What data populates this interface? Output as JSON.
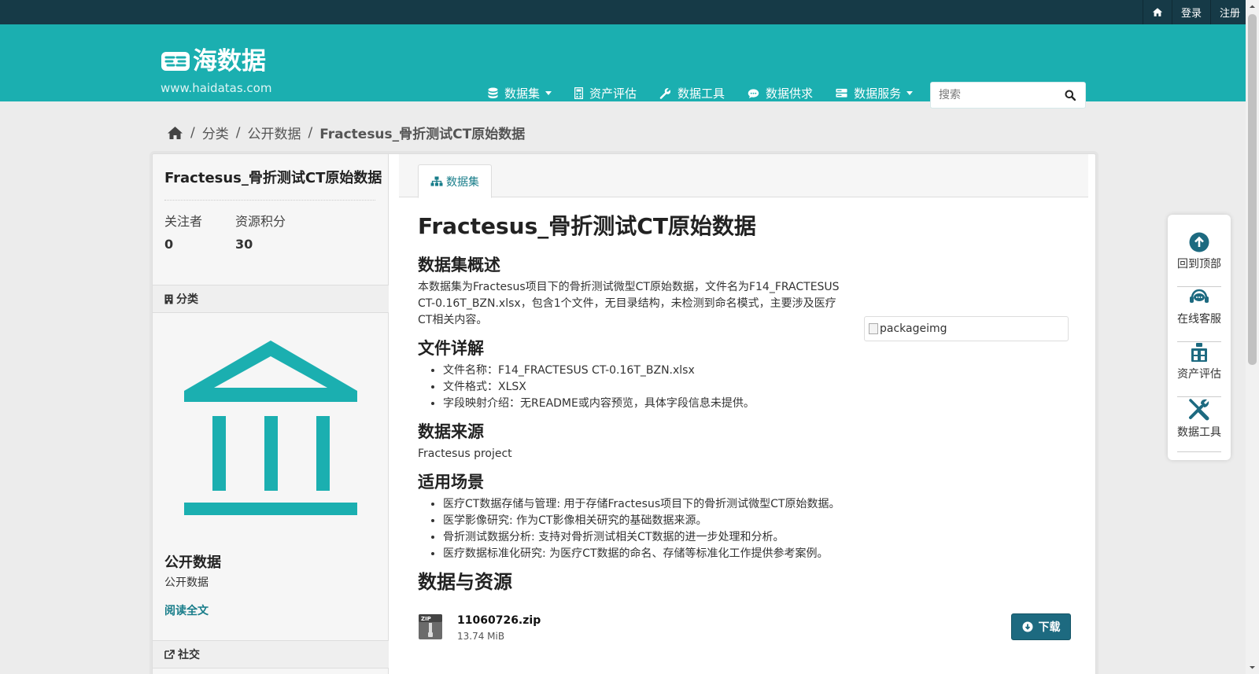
{
  "topbar": {
    "login": "登录",
    "register": "注册"
  },
  "brand": {
    "name": "海数据",
    "url": "www.haidatas.com"
  },
  "nav": [
    {
      "label": "数据集",
      "icon": "database-icon",
      "dropdown": true
    },
    {
      "label": "资产评估",
      "icon": "calculator-icon",
      "dropdown": false
    },
    {
      "label": "数据工具",
      "icon": "wrench-icon",
      "dropdown": false
    },
    {
      "label": "数据供求",
      "icon": "chat-icon",
      "dropdown": false
    },
    {
      "label": "数据服务",
      "icon": "server-icon",
      "dropdown": true
    }
  ],
  "search": {
    "placeholder": "搜索"
  },
  "breadcrumb": {
    "item1": "分类",
    "item2": "公开数据",
    "current": "Fractesus_骨折测试CT原始数据"
  },
  "sidebar": {
    "title": "Fractesus_骨折测试CT原始数据",
    "followers_label": "关注者",
    "followers": "0",
    "points_label": "资源积分",
    "points": "30",
    "category_head": "分类",
    "org_name": "公开数据",
    "org_desc": "公开数据",
    "read_more": "阅读全文",
    "social_head": "社交"
  },
  "tabs": {
    "dataset": "数据集"
  },
  "main": {
    "title": "Fractesus_骨折测试CT原始数据",
    "overview_h": "数据集概述",
    "overview_p": "本数据集为Fractesus项目下的骨折测试微型CT原始数据，文件名为F14_FRACTESUS CT-0.16T_BZN.xlsx，包含1个文件，无目录结构，未检测到命名模式，主要涉及医疗CT相关内容。",
    "image_alt": "packageimg",
    "files_h": "文件详解",
    "files": [
      "文件名称：F14_FRACTESUS CT-0.16T_BZN.xlsx",
      "文件格式：XLSX",
      "字段映射介绍：无README或内容预览，具体字段信息未提供。"
    ],
    "source_h": "数据来源",
    "source_p": "Fractesus project",
    "usage_h": "适用场景",
    "usage": [
      "医疗CT数据存储与管理: 用于存储Fractesus项目下的骨折测试微型CT原始数据。",
      "医学影像研究: 作为CT影像相关研究的基础数据来源。",
      "骨折测试数据分析: 支持对骨折测试相关CT数据的进一步处理和分析。",
      "医疗数据标准化研究: 为医疗CT数据的命名、存储等标准化工作提供参考案例。"
    ],
    "resources_h": "数据与资源",
    "resource": {
      "name": "11060726.zip",
      "size": "13.74 MiB",
      "badge": "ZIP",
      "download": "下载"
    }
  },
  "floatbar": [
    {
      "label": "回到顶部",
      "icon": "arrow-up-circle-icon"
    },
    {
      "label": "在线客服",
      "icon": "headset-icon"
    },
    {
      "label": "资产评估",
      "icon": "assessment-icon"
    },
    {
      "label": "数据工具",
      "icon": "tools-icon"
    }
  ],
  "colors": {
    "header": "#1bafb0",
    "topbar": "#163a47",
    "accent": "#187d8a",
    "button": "#1d6a80"
  }
}
